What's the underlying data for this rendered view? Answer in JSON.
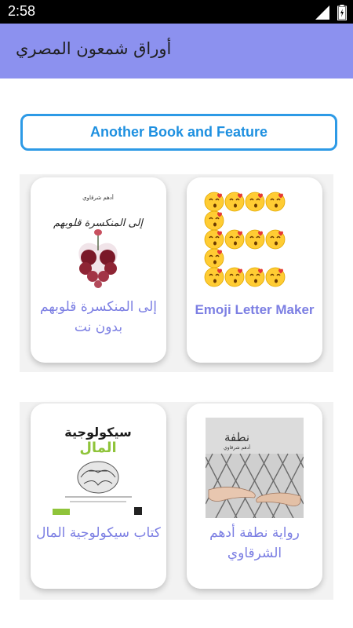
{
  "status_bar": {
    "time": "2:58"
  },
  "app_bar": {
    "title": "أوراق شمعون المصري"
  },
  "feature_button": {
    "label": "Another Book and Feature"
  },
  "cards": [
    {
      "label": "إلى المنكسرة قلوبهم بدون نت",
      "cover": {
        "author": "أدهم شرقاوي",
        "title": "إلى المنكسرة قلوبهم"
      }
    },
    {
      "label": "Emoji Letter Maker"
    },
    {
      "label": "كتاب سيكولوجية المال",
      "cover": {
        "title_top": "سيكولوجية",
        "title_bottom": "المال"
      }
    },
    {
      "label": "رواية نطفة أدهم الشرقاوي",
      "cover": {
        "title": "نطفة",
        "author": "أدهم شرقاوي"
      }
    }
  ],
  "colors": {
    "app_bar": "#8c91ef",
    "accent_button": "#2d9ae6",
    "card_label": "#7c7fe3"
  }
}
